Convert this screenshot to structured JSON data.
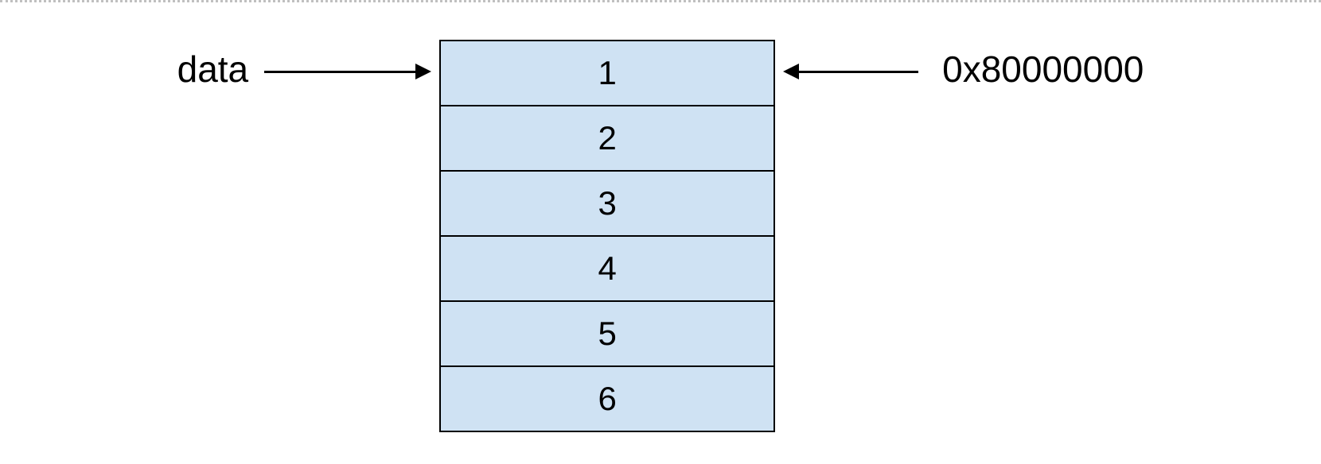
{
  "leftLabel": "data",
  "rightLabel": "0x80000000",
  "cells": [
    "1",
    "2",
    "3",
    "4",
    "5",
    "6"
  ]
}
